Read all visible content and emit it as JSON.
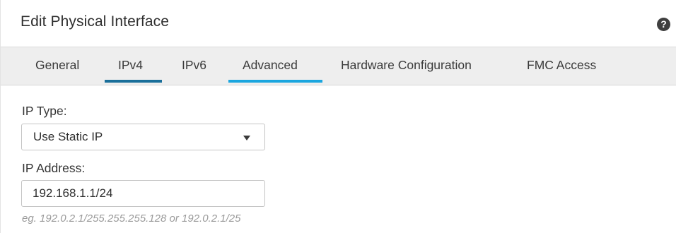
{
  "dialog": {
    "title": "Edit Physical Interface",
    "help_icon": "?"
  },
  "tabs": [
    {
      "label": "General",
      "active": false
    },
    {
      "label": "IPv4",
      "active": true
    },
    {
      "label": "IPv6",
      "active": false
    },
    {
      "label": "Advanced",
      "active": false
    },
    {
      "label": "Hardware Configuration",
      "active": false
    },
    {
      "label": "FMC Access",
      "active": false
    }
  ],
  "colors": {
    "active_tab_underline": "#1a6f9a",
    "secondary_tab_underline": "#1ba6df",
    "tab_bar_bg": "#eeeeee",
    "hint_text": "#9a9a9a"
  },
  "form": {
    "ip_type": {
      "label": "IP Type:",
      "selected": "Use Static IP"
    },
    "ip_address": {
      "label": "IP Address:",
      "value": "192.168.1.1/24",
      "hint": "eg. 192.0.2.1/255.255.255.128 or 192.0.2.1/25"
    }
  }
}
